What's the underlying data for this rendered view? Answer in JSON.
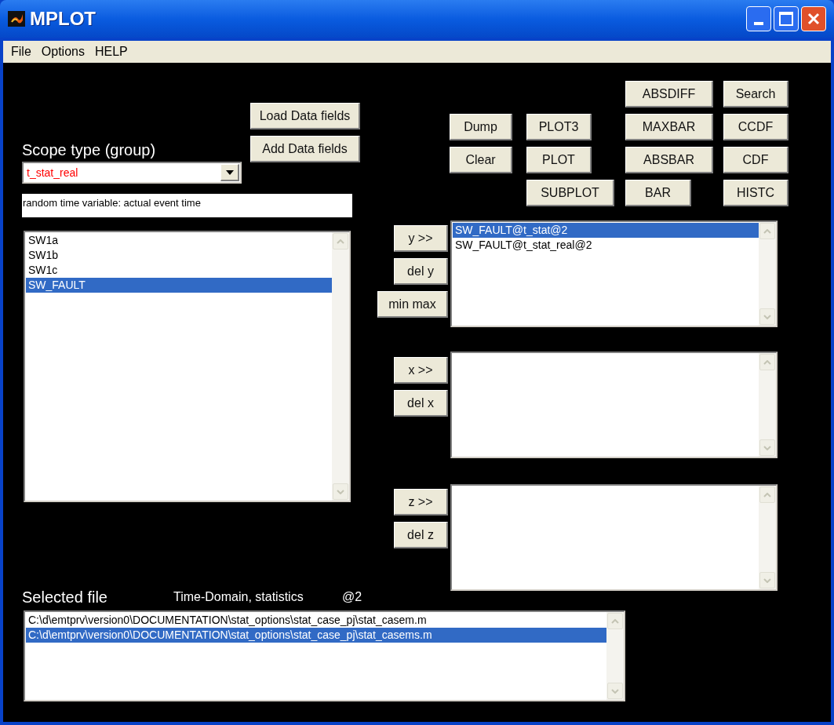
{
  "window": {
    "title": "MPLOT"
  },
  "menu": [
    "File",
    "Options",
    "HELP"
  ],
  "data_buttons": [
    "Load Data fields",
    "Add Data fields"
  ],
  "scope": {
    "label": "Scope type (group)",
    "value": "t_stat_real",
    "description": "random time variable: actual event time"
  },
  "signals": [
    {
      "label": "SW1a",
      "selected": false
    },
    {
      "label": "SW1b",
      "selected": false
    },
    {
      "label": "SW1c",
      "selected": false
    },
    {
      "label": "SW_FAULT",
      "selected": true
    }
  ],
  "plot_buttons": [
    "ABSDIFF",
    "Search",
    "Dump",
    "PLOT3",
    "MAXBAR",
    "CCDF",
    "Clear",
    "PLOT",
    "ABSBAR",
    "CDF",
    "SUBPLOT",
    "BAR",
    "HISTC"
  ],
  "y_axis": {
    "buttons": [
      "y >>",
      "del y",
      "min max"
    ],
    "items": [
      {
        "label": "SW_FAULT@t_stat@2",
        "selected": true
      },
      {
        "label": "SW_FAULT@t_stat_real@2",
        "selected": false
      }
    ]
  },
  "x_axis": {
    "buttons": [
      "x >>",
      "del x"
    ]
  },
  "z_axis": {
    "buttons": [
      "z >>",
      "del z"
    ]
  },
  "selected_file": {
    "label": "Selected file",
    "domain": "Time-Domain, statistics",
    "case": "@2",
    "files": [
      {
        "label": "C:\\d\\emtprv\\version0\\DOCUMENTATION\\stat_options\\stat_case_pj\\stat_casem.m",
        "selected": false
      },
      {
        "label": "C:\\d\\emtprv\\version0\\DOCUMENTATION\\stat_options\\stat_case_pj\\stat_casems.m",
        "selected": true
      }
    ]
  }
}
